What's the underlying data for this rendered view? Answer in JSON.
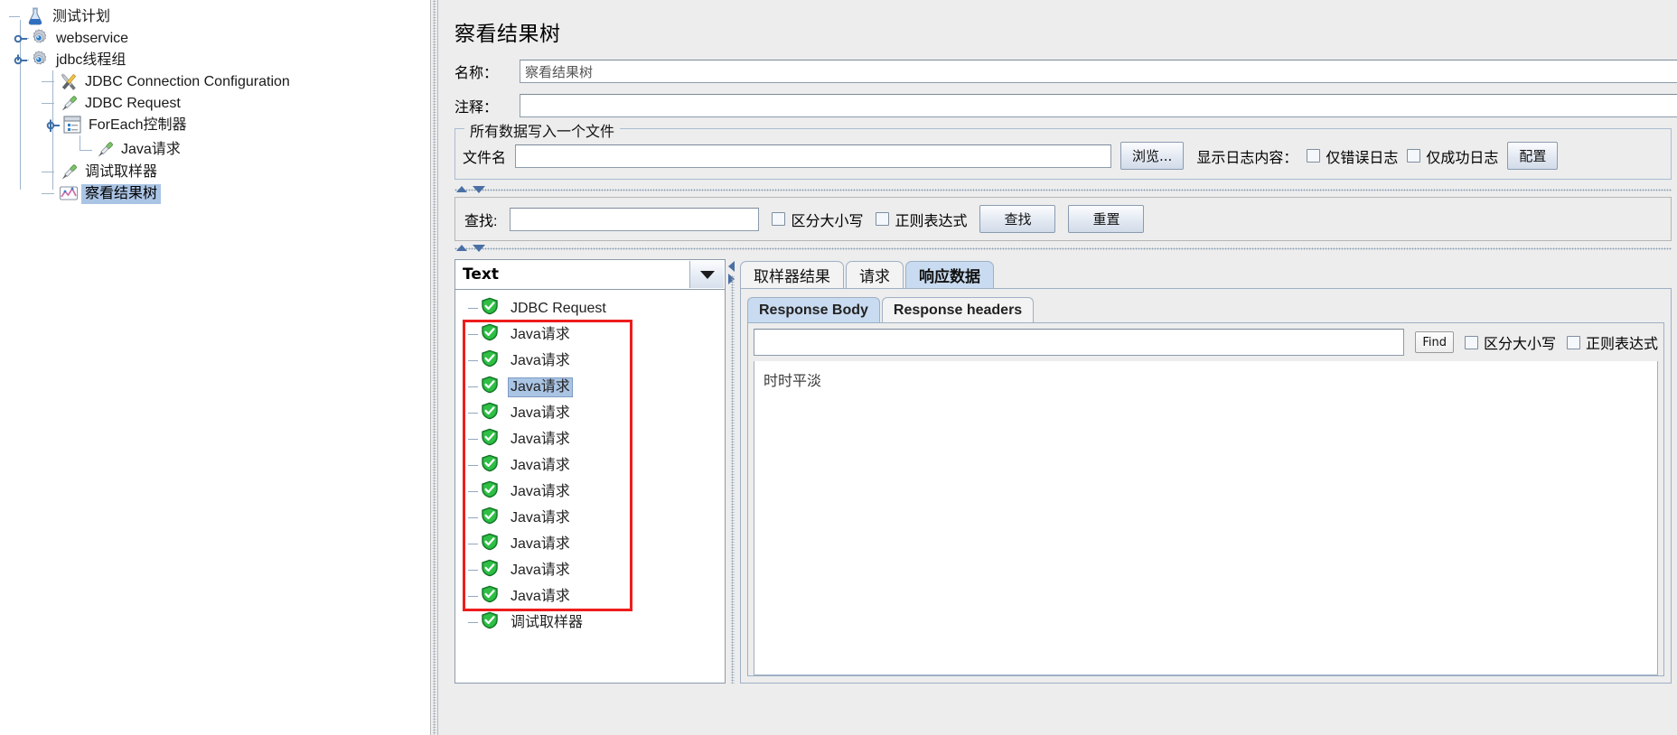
{
  "tree": {
    "items": [
      {
        "label": "测试计划",
        "icon": "flask-icon",
        "depth": 0,
        "selected": false,
        "handle": "none"
      },
      {
        "label": "webservice",
        "icon": "gear-icon",
        "depth": 1,
        "selected": false,
        "handle": "collapsed"
      },
      {
        "label": "jdbc线程组",
        "icon": "gear-icon",
        "depth": 1,
        "selected": false,
        "handle": "expanded"
      },
      {
        "label": "JDBC Connection Configuration",
        "icon": "wrench-screwdriver-icon",
        "depth": 2,
        "selected": false,
        "handle": "none"
      },
      {
        "label": "JDBC Request",
        "icon": "pipette-icon",
        "depth": 2,
        "selected": false,
        "handle": "none"
      },
      {
        "label": "ForEach控制器",
        "icon": "controller-icon",
        "depth": 2,
        "selected": false,
        "handle": "expanded"
      },
      {
        "label": "Java请求",
        "icon": "pipette-icon",
        "depth": 3,
        "selected": false,
        "handle": "none"
      },
      {
        "label": "调试取样器",
        "icon": "pipette-icon",
        "depth": 2,
        "selected": false,
        "handle": "none"
      },
      {
        "label": "察看结果树",
        "icon": "results-tree-icon",
        "depth": 2,
        "selected": true,
        "handle": "none"
      }
    ]
  },
  "panel": {
    "title": "察看结果树",
    "name_label": "名称：",
    "name_value": "察看结果树",
    "comment_label": "注释：",
    "comment_value": "",
    "filewrite": {
      "group_title": "所有数据写入一个文件",
      "filename_label": "文件名",
      "filename_value": "",
      "browse_button": "浏览...",
      "log_display_label": "显示日志内容：",
      "errors_only": "仅错误日志",
      "success_only": "仅成功日志",
      "configure_button": "配置"
    }
  },
  "searchbar": {
    "find_label": "查找:",
    "find_value": "",
    "case_sensitive": "区分大小写",
    "regex": "正则表达式",
    "search_button": "查找",
    "reset_button": "重置"
  },
  "results": {
    "renderer_selected": "Text",
    "rows": [
      {
        "label": "JDBC Request",
        "status": "success",
        "selected": false,
        "boxed": false
      },
      {
        "label": "Java请求",
        "status": "success",
        "selected": false,
        "boxed": true
      },
      {
        "label": "Java请求",
        "status": "success",
        "selected": false,
        "boxed": true
      },
      {
        "label": "Java请求",
        "status": "success",
        "selected": true,
        "boxed": true
      },
      {
        "label": "Java请求",
        "status": "success",
        "selected": false,
        "boxed": true
      },
      {
        "label": "Java请求",
        "status": "success",
        "selected": false,
        "boxed": true
      },
      {
        "label": "Java请求",
        "status": "success",
        "selected": false,
        "boxed": true
      },
      {
        "label": "Java请求",
        "status": "success",
        "selected": false,
        "boxed": true
      },
      {
        "label": "Java请求",
        "status": "success",
        "selected": false,
        "boxed": true
      },
      {
        "label": "Java请求",
        "status": "success",
        "selected": false,
        "boxed": true
      },
      {
        "label": "Java请求",
        "status": "success",
        "selected": false,
        "boxed": true
      },
      {
        "label": "Java请求",
        "status": "success",
        "selected": false,
        "boxed": true
      },
      {
        "label": "调试取样器",
        "status": "success",
        "selected": false,
        "boxed": false
      }
    ]
  },
  "tabs": {
    "items": [
      {
        "label": "取样器结果",
        "active": false
      },
      {
        "label": "请求",
        "active": false
      },
      {
        "label": "响应数据",
        "active": true
      }
    ],
    "subtabs": [
      {
        "label": "Response Body",
        "active": true
      },
      {
        "label": "Response headers",
        "active": false
      }
    ],
    "find": {
      "value": "",
      "find_button": "Find",
      "case_sensitive": "区分大小写",
      "regex": "正则表达式"
    },
    "response_body": "时时平淡"
  },
  "colors": {
    "selection": "#aac4e4",
    "highlight_box": "#ee1c1c",
    "panel_bg": "#ededed",
    "success_green": "#23a13a"
  }
}
